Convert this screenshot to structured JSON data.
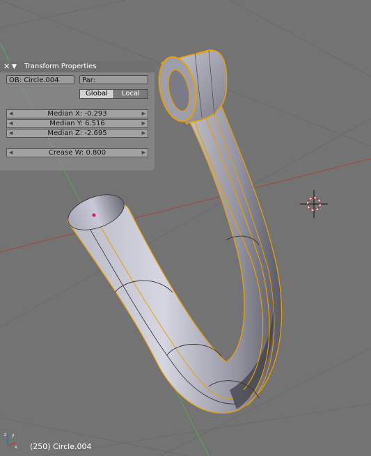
{
  "panel": {
    "title": "Transform Properties",
    "object_name": "OB: Circle.004",
    "parent_field": "Par:",
    "global_label": "Global",
    "local_label": "Local",
    "median_x": "Median X: -0.293",
    "median_y": "Median Y: 6.516",
    "median_z": "Median Z: -2.695",
    "crease_w": "Crease W: 0.800"
  },
  "status": {
    "frame_object": "(250) Circle.004"
  },
  "icons": {
    "close": "close-icon",
    "collapse": "triangle-down-icon",
    "cursor": "3d-cursor-icon",
    "axes": "axis-gizmo-icon"
  },
  "colors": {
    "background": "#737373",
    "selection_edge": "#f0a000",
    "grid_x_axis": "#a8443f",
    "grid_y_axis": "#5aa65a",
    "toggle_active": "#d2d2d2",
    "toggle_inactive": "#7a7a7a"
  }
}
